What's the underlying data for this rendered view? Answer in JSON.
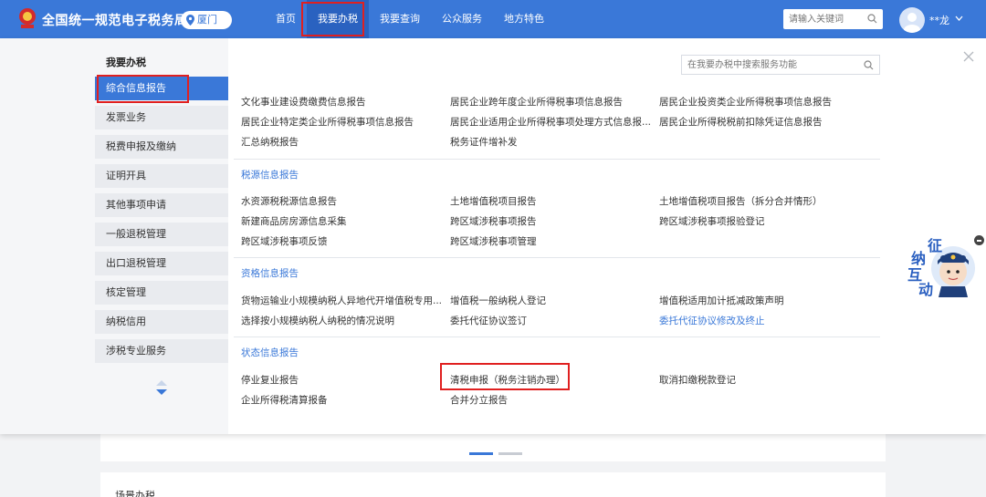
{
  "header": {
    "site_title": "全国统一规范电子税务局",
    "city": "厦门",
    "nav": [
      {
        "label": "首页"
      },
      {
        "label": "我要办税"
      },
      {
        "label": "我要查询"
      },
      {
        "label": "公众服务"
      },
      {
        "label": "地方特色"
      }
    ],
    "search_placeholder": "请输入关键词",
    "user_name": "**龙"
  },
  "sidebar": {
    "title": "我要办税",
    "items": [
      {
        "label": "综合信息报告"
      },
      {
        "label": "发票业务"
      },
      {
        "label": "税费申报及缴纳"
      },
      {
        "label": "证明开具"
      },
      {
        "label": "其他事项申请"
      },
      {
        "label": "一般退税管理"
      },
      {
        "label": "出口退税管理"
      },
      {
        "label": "核定管理"
      },
      {
        "label": "纳税信用"
      },
      {
        "label": "涉税专业服务"
      }
    ]
  },
  "content": {
    "search_placeholder": "在我要办税中搜索服务功能",
    "groups": [
      {
        "title": "",
        "links": [
          "文化事业建设费缴费信息报告",
          "居民企业跨年度企业所得税事项信息报告",
          "居民企业投资类企业所得税事项信息报告",
          "居民企业特定类企业所得税事项信息报告",
          "居民企业适用企业所得税事项处理方式信息报...",
          "居民企业所得税税前扣除凭证信息报告",
          "汇总纳税报告",
          "税务证件增补发"
        ]
      },
      {
        "title": "税源信息报告",
        "links": [
          "水资源税税源信息报告",
          "土地增值税项目报告",
          "土地增值税项目报告（拆分合并情形）",
          "新建商品房房源信息采集",
          "跨区域涉税事项报告",
          "跨区域涉税事项报验登记",
          "跨区域涉税事项反馈",
          "跨区域涉税事项管理"
        ]
      },
      {
        "title": "资格信息报告",
        "links": [
          "货物运输业小规模纳税人异地代开增值税专用...",
          "增值税一般纳税人登记",
          "增值税适用加计抵减政策声明",
          "选择按小规模纳税人纳税的情况说明",
          "委托代征协议签订",
          "委托代征协议修改及终止"
        ]
      },
      {
        "title": "状态信息报告",
        "links": [
          "停业复业报告",
          "清税申报（税务注销办理）",
          "取消扣缴税款登记",
          "企业所得税清算报备",
          "合并分立报告"
        ]
      }
    ]
  },
  "assistant": {
    "chars": [
      "征",
      "纳",
      "互",
      "动"
    ]
  },
  "background": {
    "card_title": "场景办税"
  },
  "colors": {
    "header_bg": "#3a78d8",
    "active_blue": "#3a78d8",
    "highlight_red": "#e02020"
  }
}
